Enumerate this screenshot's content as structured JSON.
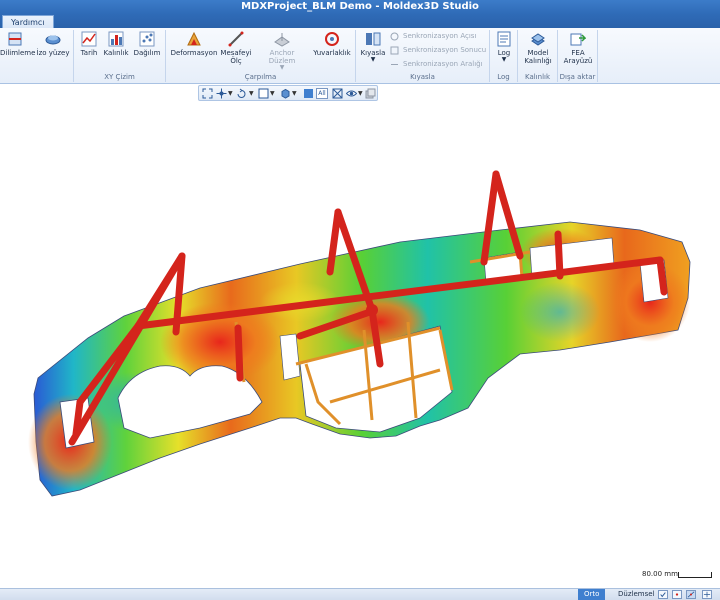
{
  "window": {
    "title": "MDXProject_BLM Demo - Moldex3D Studio"
  },
  "tabs": [
    {
      "label": "Yardımcı"
    }
  ],
  "ribbon": {
    "buttons": {
      "dilimleme": "Dilimleme",
      "izo_yuzey": "İzo yüzey",
      "tarih": "Tarih",
      "kalinlik": "Kalınlık",
      "dagilim": "Dağılım",
      "deformasyon": "Deformasyon",
      "mesafeyi_olc_1": "Mesafeyi",
      "mesafeyi_olc_2": "Ölç",
      "anchor_duzlem": "Anchor Düzlem",
      "yuvarlaklik": "Yuvarlaklık",
      "kiyasla": "Kıyasla",
      "senk_acisi": "Senkronizasyon Açısı",
      "senk_sonucu": "Senkronizasyon Sonucu",
      "senk_araligi": "Senkronizasyon Aralığı",
      "log": "Log",
      "model_kalinligi_1": "Model",
      "model_kalinligi_2": "Kalınlığı",
      "fea_arayuzu_1": "FEA",
      "fea_arayuzu_2": "Arayüzü"
    },
    "groups": {
      "xy_cizim": "XY Çizim",
      "carpilma": "Çarpılma",
      "kiyasla": "Kıyasla",
      "log": "Log",
      "kalinlik": "Kalınlık",
      "disa_aktar": "Dışa aktar"
    }
  },
  "viewbar": {
    "all_label": "All"
  },
  "scale": {
    "label": "80.00 mm"
  },
  "status": {
    "orto": "Orto",
    "duzlemsel": "Düzlemsel"
  },
  "colors": {
    "title_bar": "#2f6bb7",
    "frame_red": "#d4241c",
    "accent": "#3f7fcf"
  }
}
